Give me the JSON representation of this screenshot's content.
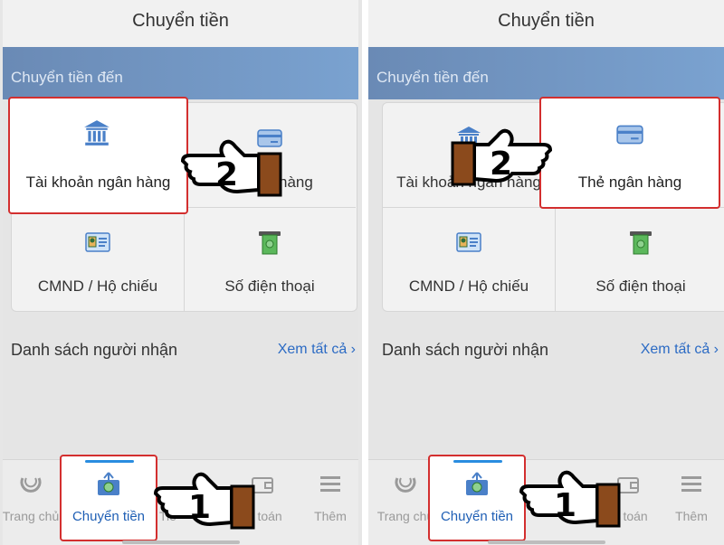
{
  "screen_title": "Chuyển tiền",
  "section_label": "Chuyển tiền đến",
  "options": {
    "bank_account": "Tài khoản ngân hàng",
    "bank_card": "Thẻ ngân hàng",
    "id_card": "CMND / Hộ chiếu",
    "phone": "Số điện thoại"
  },
  "recipients": {
    "label": "Danh sách người nhận",
    "view_all": "Xem tất cả"
  },
  "nav": {
    "home": "Trang chủ",
    "transfer": "Chuyển tiền",
    "third": "Tiền",
    "payment": "Thanh toán",
    "more": "Thêm"
  },
  "left_truncated": {
    "card_option": "hàng",
    "nav_third": "Tiề",
    "nav_payment": "nh toán"
  },
  "right_truncated": {
    "bank_account": "Tài khoản ngân hàng",
    "nav_home": "Trang chủ"
  },
  "annotations": {
    "step1": "1",
    "step2": "2"
  },
  "colors": {
    "highlight": "#d32f2f",
    "accent": "#2a8de0",
    "banner": "#6a8ab5"
  }
}
